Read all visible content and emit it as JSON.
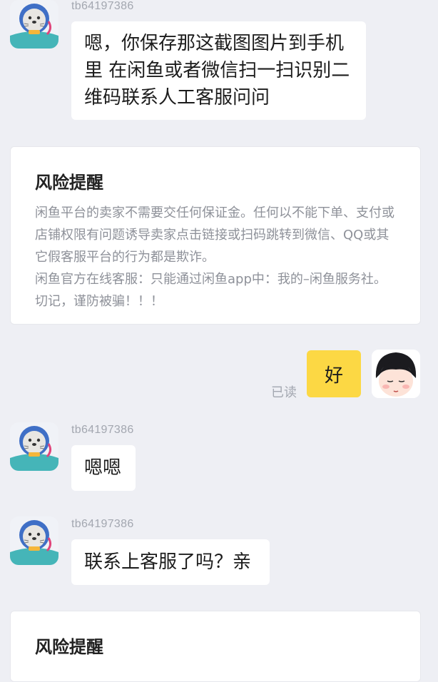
{
  "messages": [
    {
      "username": "tb64197386",
      "text": "嗯，你保存那这截图图片到手机里 在闲鱼或者微信扫一扫识别二维码联系人工客服问问"
    },
    {
      "username": "tb64197386",
      "text": "嗯嗯"
    },
    {
      "username": "tb64197386",
      "text": "联系上客服了吗？亲"
    }
  ],
  "risk_card_1": {
    "title": "风险提醒",
    "body": "闲鱼平台的卖家不需要交任何保证金。任何以不能下单、支付或店铺权限有问题诱导卖家点击链接或扫码跳转到微信、QQ或其它假客服平台的行为都是欺诈。",
    "body2": "闲鱼官方在线客服：只能通过闲鱼app中：我的–闲鱼服务社。切记，谨防被骗！！！"
  },
  "risk_card_2": {
    "title": "风险提醒"
  },
  "my_message": {
    "text": "好",
    "status": "已读"
  },
  "colors": {
    "background": "#eeeff4",
    "bubble_self": "#fcd844",
    "bubble_other": "#ffffff",
    "muted_text": "#a3a7b0"
  },
  "icons": {
    "other_avatar": "seal-avatar-icon",
    "self_avatar": "girl-avatar-icon"
  }
}
